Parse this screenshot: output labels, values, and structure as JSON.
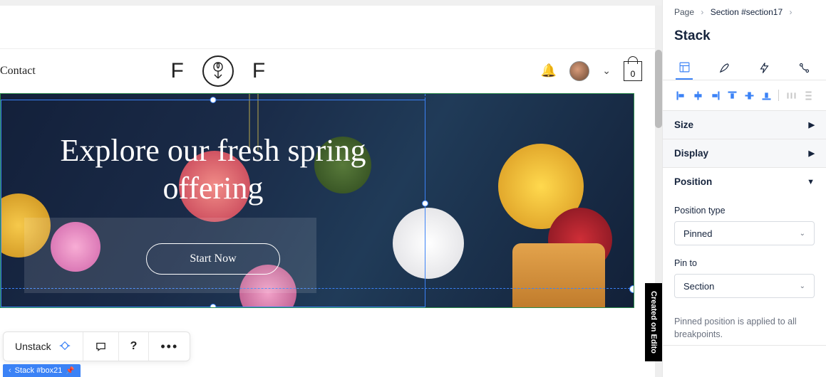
{
  "breadcrumb": {
    "root": "Page",
    "section": "Section #section17"
  },
  "panel": {
    "title": "Stack",
    "accordions": {
      "size": "Size",
      "display": "Display",
      "position": "Position"
    },
    "position": {
      "type_label": "Position type",
      "type_value": "Pinned",
      "pin_label": "Pin to",
      "pin_value": "Section",
      "note": "Pinned position is applied to all breakpoints."
    }
  },
  "site": {
    "nav_contact": "Contact",
    "logo_left": "F",
    "logo_right": "F",
    "bag_count": "0"
  },
  "hero": {
    "title": "Explore our fresh spring offering",
    "cta": "Start Now"
  },
  "sidetag": "Created on Edito",
  "bottom": {
    "unstack": "Unstack",
    "question": "?"
  },
  "chip": {
    "lt": "‹",
    "label": "Stack #box21"
  }
}
